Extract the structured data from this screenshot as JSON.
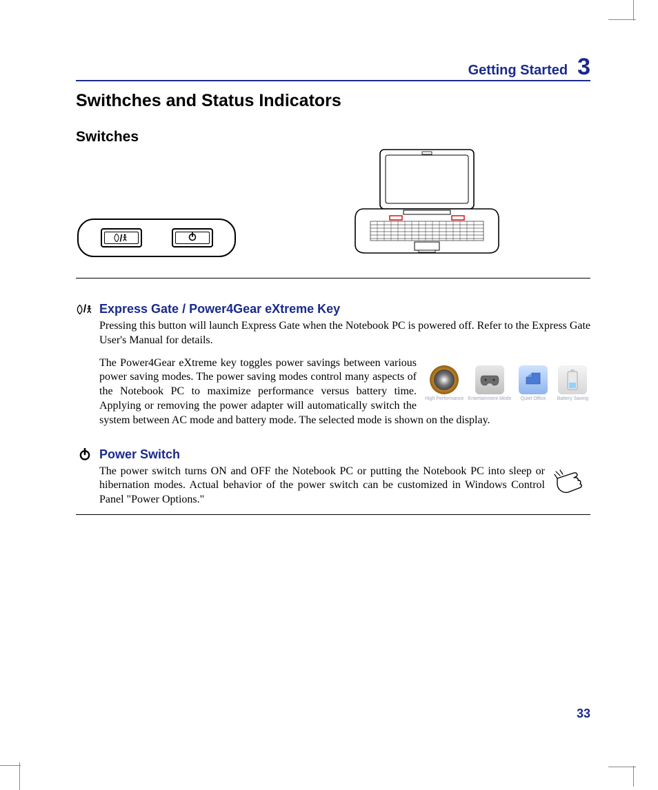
{
  "running_head": {
    "title": "Getting Started",
    "chapter_number": "3"
  },
  "section_title": "Swithches and Status Indicators",
  "switches_subtitle": "Switches",
  "page_number": "33",
  "express_gate": {
    "icon_name": "express-gate-power4gear-icon",
    "title": "Express Gate / Power4Gear eXtreme Key",
    "para1": "Pressing this button will launch Express Gate when the Notebook PC is powered off. Refer to the Express Gate User's Manual for details.",
    "para2": "The Power4Gear eXtreme key toggles power savings between various power saving modes. The power saving modes control many aspects of the Notebook PC to maximize performance versus battery time. Applying or removing the power adapter will automatically switch the system between AC mode and battery mode. The selected mode is shown on the display.",
    "modes": [
      {
        "label": "High Performance"
      },
      {
        "label": "Entertainment Mode"
      },
      {
        "label": "Quiet Office"
      },
      {
        "label": "Battery Saving"
      }
    ]
  },
  "power_switch": {
    "icon_name": "power-icon",
    "title": "Power Switch",
    "para": "The power switch turns ON and OFF the Notebook PC or putting the Notebook PC into sleep or hibernation modes. Actual behavior of the power switch can be customized in Windows Control Panel \"Power Options.\""
  }
}
